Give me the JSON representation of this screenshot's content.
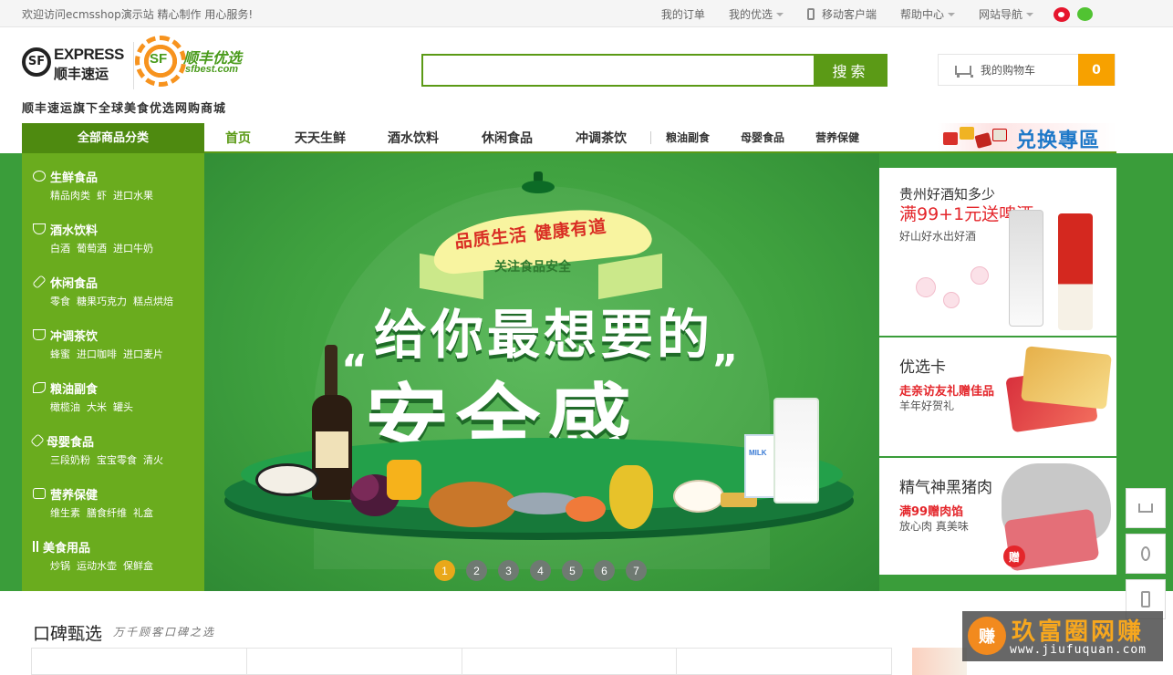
{
  "topbar": {
    "welcome": "欢迎访问ecmsshop演示站 精心制作 用心服务!",
    "my_orders": "我的订单",
    "my_youxuan": "我的优选",
    "mobile": "移动客户端",
    "help": "帮助中心",
    "site_nav": "网站导航"
  },
  "logo": {
    "express": "EXPRESS",
    "sf_cn": "顺丰速运",
    "sf_badge": "SF",
    "best_cn": "顺丰优选",
    "best_en": "sfbest.com",
    "slogan": "顺丰速运旗下全球美食优选网购商城"
  },
  "search": {
    "value": "",
    "placeholder": "",
    "button": "搜索"
  },
  "cart": {
    "label": "我的购物车",
    "count": "0"
  },
  "nav": {
    "all_categories": "全部商品分类",
    "items": [
      "首页",
      "天天生鲜",
      "酒水饮料",
      "休闲食品",
      "冲调茶饮",
      "粮油副食",
      "母婴食品",
      "营养保健"
    ],
    "exchange": "兑换專區"
  },
  "categories": [
    {
      "title": "生鲜食品",
      "subs": [
        "精品肉类",
        "虾",
        "进口水果"
      ]
    },
    {
      "title": "酒水饮料",
      "subs": [
        "白酒",
        "葡萄酒",
        "进口牛奶"
      ]
    },
    {
      "title": "休闲食品",
      "subs": [
        "零食",
        "糖果巧克力",
        "糕点烘焙"
      ]
    },
    {
      "title": "冲调茶饮",
      "subs": [
        "蜂蜜",
        "进口咖啡",
        "进口麦片"
      ]
    },
    {
      "title": "粮油副食",
      "subs": [
        "橄榄油",
        "大米",
        "罐头"
      ]
    },
    {
      "title": "母婴食品",
      "subs": [
        "三段奶粉",
        "宝宝零食",
        "清火"
      ]
    },
    {
      "title": "营养保健",
      "subs": [
        "维生素",
        "膳食纤维",
        "礼盒"
      ]
    },
    {
      "title": "美食用品",
      "subs": [
        "炒锅",
        "运动水壶",
        "保鲜盒"
      ]
    }
  ],
  "hero": {
    "ribbon": "品质生活 健康有道",
    "ribbon_sub": "关注食品安全",
    "line1": "给你最想要的",
    "line2": "安全感",
    "open_quote": "“",
    "close_quote": "”",
    "milk": "MILK",
    "slides": [
      "1",
      "2",
      "3",
      "4",
      "5",
      "6",
      "7"
    ],
    "active_slide": 1
  },
  "promos": [
    {
      "title": "贵州好酒知多少",
      "highlight": "满99+1元送啤酒",
      "desc": "好山好水出好酒"
    },
    {
      "title": "优选卡",
      "highlight": "走亲访友礼赠佳品",
      "desc": "羊年好贺礼"
    },
    {
      "title": "精气神黑猪肉",
      "highlight": "满99赠肉馅",
      "desc": "放心肉 真美味",
      "badge": "赠"
    }
  ],
  "section": {
    "title": "口碑甄选",
    "subtitle": "万千顾客口碑之选"
  },
  "watermark": {
    "cn": "玖富圈网赚",
    "en": "www.jiufuquan.com",
    "logo": "赚"
  },
  "colors": {
    "brand_green": "#5b9a16",
    "cart_orange": "#f7a100",
    "promo_red": "#e4262b",
    "exchange_blue": "#1e78c8"
  }
}
